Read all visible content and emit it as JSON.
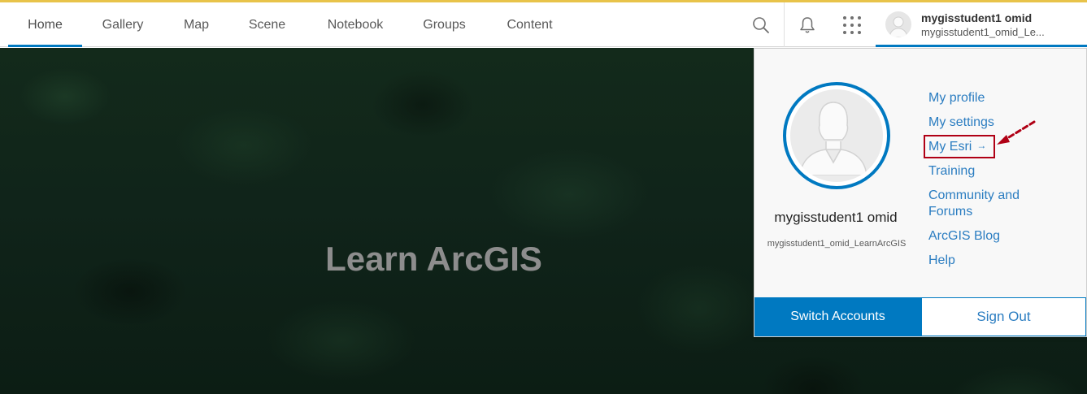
{
  "nav": {
    "items": [
      {
        "label": "Home",
        "active": true
      },
      {
        "label": "Gallery"
      },
      {
        "label": "Map"
      },
      {
        "label": "Scene"
      },
      {
        "label": "Notebook"
      },
      {
        "label": "Groups"
      },
      {
        "label": "Content"
      }
    ]
  },
  "header_tools": {
    "search_icon": "search-icon",
    "notifications_icon": "bell-icon",
    "apps_icon": "app-launcher-icon"
  },
  "user": {
    "full_name": "mygisstudent1 omid",
    "username_truncated": "mygisstudent1_omid_Le...",
    "username": "mygisstudent1_omid_LearnArcGIS"
  },
  "hero": {
    "title": "Learn ArcGIS"
  },
  "user_menu": {
    "links": [
      {
        "label": "My profile"
      },
      {
        "label": "My settings"
      },
      {
        "label": "My Esri",
        "external": true,
        "highlighted": true
      },
      {
        "label": "Training"
      },
      {
        "label": "Community and Forums"
      },
      {
        "label": "ArcGIS Blog"
      },
      {
        "label": "Help"
      }
    ],
    "switch_accounts_label": "Switch Accounts",
    "sign_out_label": "Sign Out",
    "external_glyph": "→"
  },
  "colors": {
    "accent": "#0079c1",
    "link": "#2b7dc1",
    "annotation": "#b00015",
    "top_accent": "#e8c34a"
  }
}
